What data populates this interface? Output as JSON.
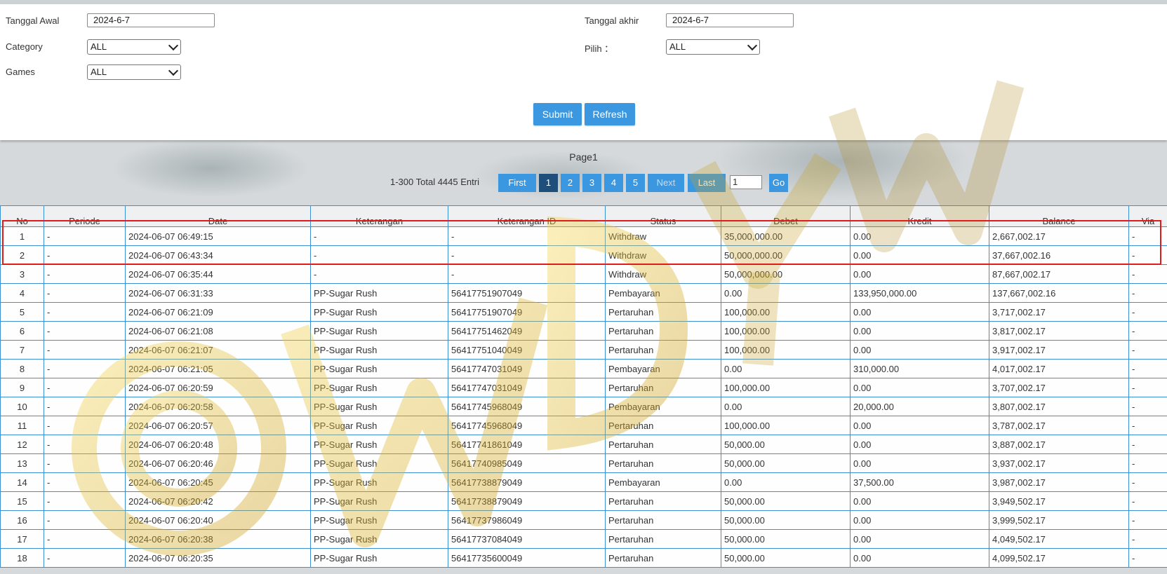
{
  "filters": {
    "tanggal_awal_label": "Tanggal Awal",
    "tanggal_awal_value": "2024-6-7",
    "tanggal_akhir_label": "Tanggal akhir",
    "tanggal_akhir_value": "2024-6-7",
    "category_label": "Category",
    "category_value": "ALL",
    "pilih_label": "Pilih ：",
    "pilih_value": "ALL",
    "games_label": "Games",
    "games_value": "ALL",
    "submit_label": "Submit",
    "refresh_label": "Refresh"
  },
  "pagination": {
    "page_title": "Page1",
    "entries_text": "1-300 Total 4445 Entri",
    "first_label": "First",
    "pages": [
      "1",
      "2",
      "3",
      "4",
      "5"
    ],
    "active_page": "1",
    "next_label": "Next",
    "last_label": "Last",
    "goto_value": "1",
    "go_label": "Go"
  },
  "table": {
    "headers": [
      "No",
      "Periode",
      "Date",
      "Keterangan",
      "Keterangan ID",
      "Status",
      "Debet",
      "Kredit",
      "Balance",
      "Via"
    ],
    "rows": [
      [
        "1",
        "-",
        "2024-06-07 06:49:15",
        "-",
        "-",
        "Withdraw",
        "35,000,000.00",
        "0.00",
        "2,667,002.17",
        "-"
      ],
      [
        "2",
        "-",
        "2024-06-07 06:43:34",
        "-",
        "-",
        "Withdraw",
        "50,000,000.00",
        "0.00",
        "37,667,002.16",
        "-"
      ],
      [
        "3",
        "-",
        "2024-06-07 06:35:44",
        "-",
        "-",
        "Withdraw",
        "50,000,000.00",
        "0.00",
        "87,667,002.17",
        "-"
      ],
      [
        "4",
        "-",
        "2024-06-07 06:31:33",
        "PP-Sugar Rush",
        "56417751907049",
        "Pembayaran",
        "0.00",
        "133,950,000.00",
        "137,667,002.16",
        "-"
      ],
      [
        "5",
        "-",
        "2024-06-07 06:21:09",
        "PP-Sugar Rush",
        "56417751907049",
        "Pertaruhan",
        "100,000.00",
        "0.00",
        "3,717,002.17",
        "-"
      ],
      [
        "6",
        "-",
        "2024-06-07 06:21:08",
        "PP-Sugar Rush",
        "56417751462049",
        "Pertaruhan",
        "100,000.00",
        "0.00",
        "3,817,002.17",
        "-"
      ],
      [
        "7",
        "-",
        "2024-06-07 06:21:07",
        "PP-Sugar Rush",
        "56417751040049",
        "Pertaruhan",
        "100,000.00",
        "0.00",
        "3,917,002.17",
        "-"
      ],
      [
        "8",
        "-",
        "2024-06-07 06:21:05",
        "PP-Sugar Rush",
        "56417747031049",
        "Pembayaran",
        "0.00",
        "310,000.00",
        "4,017,002.17",
        "-"
      ],
      [
        "9",
        "-",
        "2024-06-07 06:20:59",
        "PP-Sugar Rush",
        "56417747031049",
        "Pertaruhan",
        "100,000.00",
        "0.00",
        "3,707,002.17",
        "-"
      ],
      [
        "10",
        "-",
        "2024-06-07 06:20:58",
        "PP-Sugar Rush",
        "56417745968049",
        "Pembayaran",
        "0.00",
        "20,000.00",
        "3,807,002.17",
        "-"
      ],
      [
        "11",
        "-",
        "2024-06-07 06:20:57",
        "PP-Sugar Rush",
        "56417745968049",
        "Pertaruhan",
        "100,000.00",
        "0.00",
        "3,787,002.17",
        "-"
      ],
      [
        "12",
        "-",
        "2024-06-07 06:20:48",
        "PP-Sugar Rush",
        "56417741861049",
        "Pertaruhan",
        "50,000.00",
        "0.00",
        "3,887,002.17",
        "-"
      ],
      [
        "13",
        "-",
        "2024-06-07 06:20:46",
        "PP-Sugar Rush",
        "56417740985049",
        "Pertaruhan",
        "50,000.00",
        "0.00",
        "3,937,002.17",
        "-"
      ],
      [
        "14",
        "-",
        "2024-06-07 06:20:45",
        "PP-Sugar Rush",
        "56417738879049",
        "Pembayaran",
        "0.00",
        "37,500.00",
        "3,987,002.17",
        "-"
      ],
      [
        "15",
        "-",
        "2024-06-07 06:20:42",
        "PP-Sugar Rush",
        "56417738879049",
        "Pertaruhan",
        "50,000.00",
        "0.00",
        "3,949,502.17",
        "-"
      ],
      [
        "16",
        "-",
        "2024-06-07 06:20:40",
        "PP-Sugar Rush",
        "56417737986049",
        "Pertaruhan",
        "50,000.00",
        "0.00",
        "3,999,502.17",
        "-"
      ],
      [
        "17",
        "-",
        "2024-06-07 06:20:38",
        "PP-Sugar Rush",
        "56417737084049",
        "Pertaruhan",
        "50,000.00",
        "0.00",
        "4,049,502.17",
        "-"
      ],
      [
        "18",
        "-",
        "2024-06-07 06:20:35",
        "PP-Sugar Rush",
        "56417735600049",
        "Pertaruhan",
        "50,000.00",
        "0.00",
        "4,099,502.17",
        "-"
      ]
    ]
  },
  "colors": {
    "accent_button": "#3b97e0",
    "active_page": "#1d4f7a",
    "grid_border": "#3b8fd3",
    "withdraw_text": "#c4262e",
    "link_text": "#4a8fc7",
    "highlight_box": "#e01b1b"
  },
  "watermark_text": "WDYWK"
}
